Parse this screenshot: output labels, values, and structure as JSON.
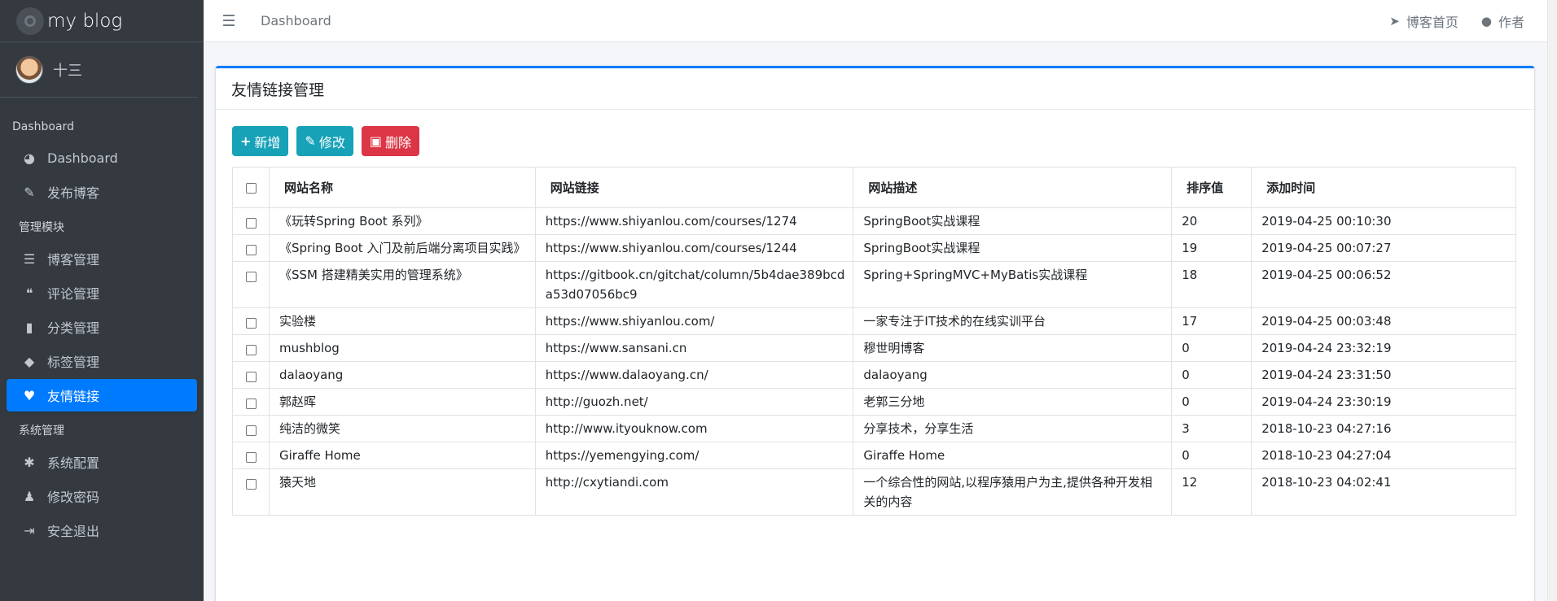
{
  "brand": {
    "title": "my blog"
  },
  "user": {
    "name": "十三"
  },
  "sidebar": {
    "sections": [
      {
        "header": "Dashboard",
        "items": [
          {
            "label": "Dashboard",
            "icon": "tachometer-icon"
          },
          {
            "label": "发布博客",
            "icon": "edit-icon"
          }
        ]
      },
      {
        "header": "管理模块",
        "items": [
          {
            "label": "博客管理",
            "icon": "list-icon"
          },
          {
            "label": "评论管理",
            "icon": "comments-icon"
          },
          {
            "label": "分类管理",
            "icon": "bookmark-icon"
          },
          {
            "label": "标签管理",
            "icon": "tags-icon"
          },
          {
            "label": "友情链接",
            "icon": "heart-icon",
            "active": true
          }
        ]
      },
      {
        "header": "系统管理",
        "items": [
          {
            "label": "系统配置",
            "icon": "wrench-icon"
          },
          {
            "label": "修改密码",
            "icon": "user-secret-icon"
          },
          {
            "label": "安全退出",
            "icon": "sign-out-icon"
          }
        ]
      }
    ]
  },
  "topnav": {
    "breadcrumb": "Dashboard",
    "links": [
      {
        "label": "博客首页",
        "icon": "paper-plane-icon"
      },
      {
        "label": "作者",
        "icon": "user-icon"
      }
    ]
  },
  "card": {
    "title": "友情链接管理"
  },
  "toolbar": {
    "add_label": "新增",
    "edit_label": "修改",
    "delete_label": "删除"
  },
  "table": {
    "columns": [
      "网站名称",
      "网站链接",
      "网站描述",
      "排序值",
      "添加时间"
    ],
    "rows": [
      [
        "《玩转Spring Boot 系列》",
        "https://www.shiyanlou.com/courses/1274",
        "SpringBoot实战课程",
        "20",
        "2019-04-25 00:10:30"
      ],
      [
        "《Spring Boot 入门及前后端分离项目实践》",
        "https://www.shiyanlou.com/courses/1244",
        "SpringBoot实战课程",
        "19",
        "2019-04-25 00:07:27"
      ],
      [
        "《SSM 搭建精美实用的管理系统》",
        "https://gitbook.cn/gitchat/column/5b4dae389bcda53d07056bc9",
        "Spring+SpringMVC+MyBatis实战课程",
        "18",
        "2019-04-25 00:06:52"
      ],
      [
        "实验楼",
        "https://www.shiyanlou.com/",
        "一家专注于IT技术的在线实训平台",
        "17",
        "2019-04-25 00:03:48"
      ],
      [
        "mushblog",
        "https://www.sansani.cn",
        "穆世明博客",
        "0",
        "2019-04-24 23:32:19"
      ],
      [
        "dalaoyang",
        "https://www.dalaoyang.cn/",
        "dalaoyang",
        "0",
        "2019-04-24 23:31:50"
      ],
      [
        "郭赵晖",
        "http://guozh.net/",
        "老郭三分地",
        "0",
        "2019-04-24 23:30:19"
      ],
      [
        "纯洁的微笑",
        "http://www.ityouknow.com",
        "分享技术，分享生活",
        "3",
        "2018-10-23 04:27:16"
      ],
      [
        "Giraffe Home",
        "https://yemengying.com/",
        "Giraffe Home",
        "0",
        "2018-10-23 04:27:04"
      ],
      [
        "猿天地",
        "http://cxytiandi.com",
        "一个综合性的网站,以程序猿用户为主,提供各种开发相关的内容",
        "12",
        "2018-10-23 04:02:41"
      ]
    ]
  },
  "colors": {
    "sidebar_bg": "#343a40",
    "active": "#007bff",
    "info": "#17a2b8",
    "danger": "#dc3545"
  }
}
